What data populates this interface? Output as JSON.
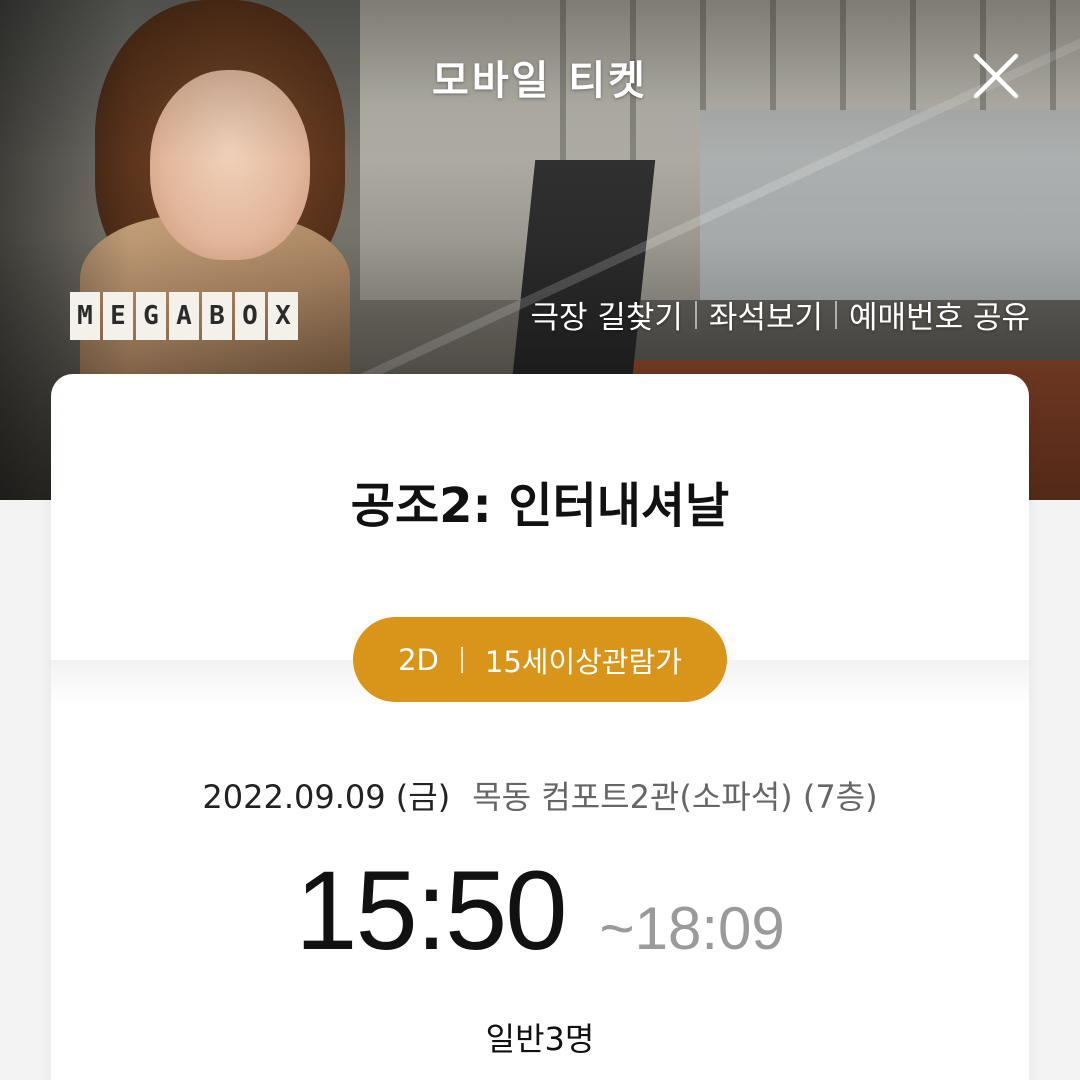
{
  "header": {
    "title": "모바일 티켓",
    "close_icon": "close-icon"
  },
  "brand": {
    "logo_text": "MEGABOX",
    "logo_letters": [
      "M",
      "E",
      "G",
      "A",
      "B",
      "O",
      "X"
    ]
  },
  "links": [
    {
      "label": "극장 길찾기"
    },
    {
      "label": "좌석보기"
    },
    {
      "label": "예매번호 공유"
    }
  ],
  "ticket": {
    "movie_title": "공조2: 인터내셔날",
    "format": "2D",
    "rating": "15세이상관람가",
    "date": "2022.09.09 (금)",
    "theater": "목동 컴포트2관(소파석) (7층)",
    "start_time": "15:50",
    "end_time": "~18:09",
    "audience": "일반3명"
  },
  "colors": {
    "accent": "#d9941a",
    "card_background": "#ffffff",
    "page_background": "#f3f3f3"
  }
}
